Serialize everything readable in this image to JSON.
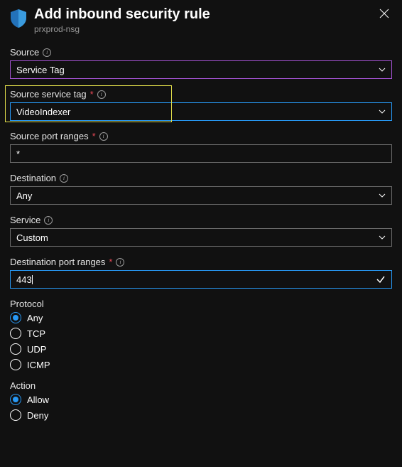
{
  "header": {
    "title": "Add inbound security rule",
    "subtitle": "prxprod-nsg"
  },
  "fields": {
    "source": {
      "label": "Source",
      "value": "Service Tag"
    },
    "serviceTag": {
      "label": "Source service tag",
      "value": "VideoIndexer"
    },
    "sourcePorts": {
      "label": "Source port ranges",
      "value": "*"
    },
    "destination": {
      "label": "Destination",
      "value": "Any"
    },
    "service": {
      "label": "Service",
      "value": "Custom"
    },
    "destPorts": {
      "label": "Destination port ranges",
      "value": "443"
    }
  },
  "protocol": {
    "label": "Protocol",
    "options": [
      "Any",
      "TCP",
      "UDP",
      "ICMP"
    ],
    "selected": "Any"
  },
  "action": {
    "label": "Action",
    "options": [
      "Allow",
      "Deny"
    ],
    "selected": "Allow"
  }
}
